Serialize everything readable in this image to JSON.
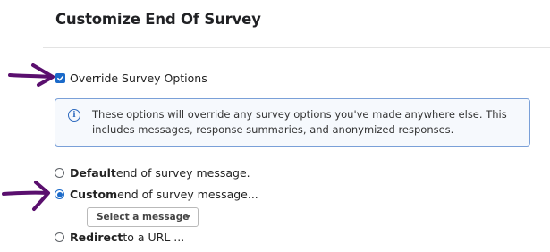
{
  "header": {
    "title": "Customize End Of Survey"
  },
  "override": {
    "label": "Override Survey Options",
    "checked": true
  },
  "info": {
    "icon": "info-icon",
    "glyph": "i",
    "text": "These options will override any survey options you've made anywhere else. This includes messages, response summaries, and anonymized responses."
  },
  "options": [
    {
      "bold": "Default",
      "rest": " end of survey message.",
      "checked": false
    },
    {
      "bold": "Custom",
      "rest": " end of survey message...",
      "checked": true
    },
    {
      "bold": "Redirect",
      "rest": " to a URL ...",
      "checked": false
    }
  ],
  "select_message": {
    "label": "Select a message"
  },
  "colors": {
    "accent": "#1b6ac9",
    "annotation": "#5a0f6e",
    "info_border": "#7aa0d8"
  }
}
